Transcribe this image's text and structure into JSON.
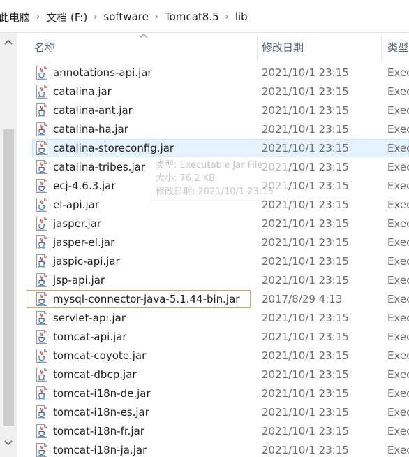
{
  "breadcrumb": [
    "此电脑",
    "文档 (F:)",
    "software",
    "Tomcat8.5",
    "lib"
  ],
  "columns": {
    "name": "名称",
    "date": "修改日期",
    "type": "类型"
  },
  "files": [
    {
      "name": "annotations-api.jar",
      "date": "2021/10/1 23:15",
      "type": "Exec"
    },
    {
      "name": "catalina.jar",
      "date": "2021/10/1 23:15",
      "type": "Exec"
    },
    {
      "name": "catalina-ant.jar",
      "date": "2021/10/1 23:15",
      "type": "Exec"
    },
    {
      "name": "catalina-ha.jar",
      "date": "2021/10/1 23:15",
      "type": "Exec"
    },
    {
      "name": "catalina-storeconfig.jar",
      "date": "2021/10/1 23:15",
      "type": "Exec"
    },
    {
      "name": "catalina-tribes.jar",
      "date": "2021/10/1 23:15",
      "type": "Exec"
    },
    {
      "name": "ecj-4.6.3.jar",
      "date": "2021/10/1 23:15",
      "type": "Exec"
    },
    {
      "name": "el-api.jar",
      "date": "2021/10/1 23:15",
      "type": "Exec"
    },
    {
      "name": "jasper.jar",
      "date": "2021/10/1 23:15",
      "type": "Exec"
    },
    {
      "name": "jasper-el.jar",
      "date": "2021/10/1 23:15",
      "type": "Exec"
    },
    {
      "name": "jaspic-api.jar",
      "date": "2021/10/1 23:15",
      "type": "Exec"
    },
    {
      "name": "jsp-api.jar",
      "date": "2021/10/1 23:15",
      "type": "Exec"
    },
    {
      "name": "mysql-connector-java-5.1.44-bin.jar",
      "date": "2017/8/29 4:13",
      "type": "Exec"
    },
    {
      "name": "servlet-api.jar",
      "date": "2021/10/1 23:15",
      "type": "Exec"
    },
    {
      "name": "tomcat-api.jar",
      "date": "2021/10/1 23:15",
      "type": "Exec"
    },
    {
      "name": "tomcat-coyote.jar",
      "date": "2021/10/1 23:15",
      "type": "Exec"
    },
    {
      "name": "tomcat-dbcp.jar",
      "date": "2021/10/1 23:15",
      "type": "Exec"
    },
    {
      "name": "tomcat-i18n-de.jar",
      "date": "2021/10/1 23:15",
      "type": "Exec"
    },
    {
      "name": "tomcat-i18n-es.jar",
      "date": "2021/10/1 23:15",
      "type": "Exec"
    },
    {
      "name": "tomcat-i18n-fr.jar",
      "date": "2021/10/1 23:15",
      "type": "Exec"
    },
    {
      "name": "tomcat-i18n-ja.jar",
      "date": "2021/10/1 23:15",
      "type": "Exec"
    }
  ],
  "hovered_index": 4,
  "focused_index": 12,
  "tooltip": {
    "type_line": "类型: Executable Jar File",
    "size_line": "大小: 76.2 KB",
    "date_line": "修改日期: 2021/10/1 23:15"
  },
  "colors": {
    "hover_bg": "#e5f3ff",
    "focus_border": "#c8a862",
    "header_text": "#4c607a",
    "java_red": "#d9331c",
    "java_blue": "#3a6fb0"
  },
  "icons": {
    "file": "java-jar-file-icon",
    "scroll_up": "chevron-up-icon",
    "scroll_down": "chevron-down-icon",
    "sort": "sort-ascending-icon"
  }
}
